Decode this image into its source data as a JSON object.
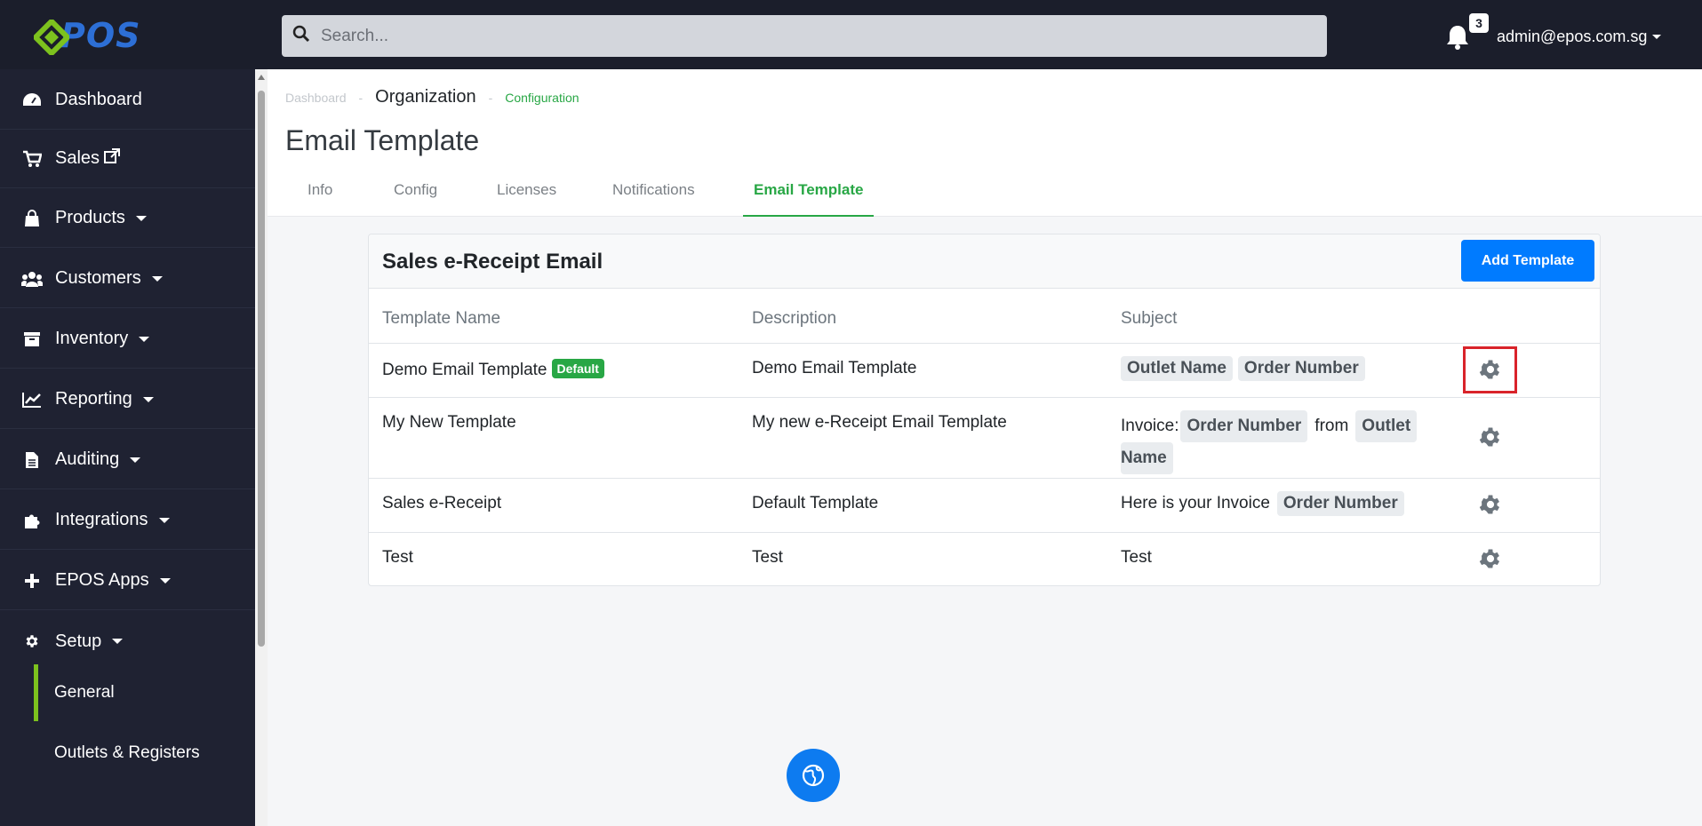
{
  "topbar": {
    "logo_text": "POS",
    "search_placeholder": "Search...",
    "notification_count": "3",
    "user_email": "admin@epos.com.sg"
  },
  "sidebar": {
    "items": [
      {
        "label": "Dashboard",
        "icon": "tachometer-icon"
      },
      {
        "label": "Sales",
        "icon": "cart-icon"
      },
      {
        "label": "Products",
        "icon": "bag-icon"
      },
      {
        "label": "Customers",
        "icon": "users-icon"
      },
      {
        "label": "Inventory",
        "icon": "archive-icon"
      },
      {
        "label": "Reporting",
        "icon": "chart-line-icon"
      },
      {
        "label": "Auditing",
        "icon": "file-icon"
      },
      {
        "label": "Integrations",
        "icon": "puzzle-icon"
      },
      {
        "label": "EPOS Apps",
        "icon": "plus-icon"
      },
      {
        "label": "Setup",
        "icon": "gear-icon"
      }
    ],
    "sub_items": [
      {
        "label": "General"
      },
      {
        "label": "Outlets & Registers"
      }
    ]
  },
  "breadcrumb": {
    "first": "Dashboard",
    "separator": "-",
    "second": "Organization",
    "third": "Configuration"
  },
  "page": {
    "title": "Email Template",
    "tabs": [
      "Info",
      "Config",
      "Licenses",
      "Notifications",
      "Email Template"
    ]
  },
  "card": {
    "title": "Sales e-Receipt Email",
    "add_button": "Add Template",
    "columns": [
      "Template Name",
      "Description",
      "Subject"
    ],
    "rows": [
      {
        "name": "Demo Email Template",
        "badge": "Default",
        "description": "Demo Email Template",
        "subject": {
          "prefix": "",
          "tag1": "Outlet Name",
          "tag2": "Order Number"
        }
      },
      {
        "name": "My New Template",
        "description": "My new e-Receipt Email Template",
        "subject": {
          "prefix": "Invoice:",
          "tag1": "Order Number",
          "middle": "from",
          "tag2a": "Outlet",
          "tag2b": "Name"
        }
      },
      {
        "name": "Sales e-Receipt",
        "description": "Default Template",
        "subject": {
          "prefix": "Here is your Invoice",
          "tag1": "Order Number"
        }
      },
      {
        "name": "Test",
        "description": "Test",
        "subject": {
          "prefix": "Test"
        }
      }
    ]
  },
  "colors": {
    "topbar_bg": "#1b1e2b",
    "sidebar_bg": "#1f2232",
    "accent_green": "#28a745",
    "primary_blue": "#007bff",
    "highlight_red": "#d9232a"
  }
}
